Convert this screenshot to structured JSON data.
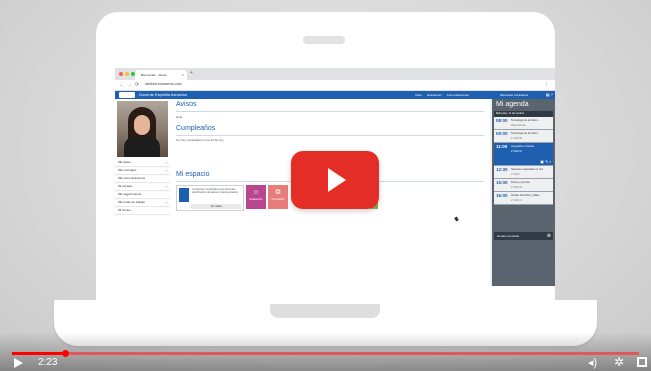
{
  "browser": {
    "tab_title": "Bienvenido · Alexia",
    "url": "alexiadi.educamos.com"
  },
  "app": {
    "title": "Docente Espinilla Asuncion",
    "menu": [
      "Inicio",
      "Evaluación",
      "Comunicaciones"
    ],
    "user": "Mercedes Cantadora"
  },
  "sidebar": {
    "photo_caption": "",
    "items": [
      {
        "label": "Mis datos"
      },
      {
        "label": "Mis mensajes"
      },
      {
        "label": "Mis comunicaciones"
      },
      {
        "label": "Mi espacio"
      },
      {
        "label": "Mis seguimientos"
      },
      {
        "label": "Mis notas de trabajo"
      },
      {
        "label": "Mi Centro"
      }
    ]
  },
  "main": {
    "avisos_title": "Avisos",
    "avisos_text": "Hola",
    "cumple_title": "Cumpleaños",
    "cumple_text": "No hay cumpleaños en la fecha hoy",
    "espacio_title": "Mi espacio",
    "card_desc": "Contenido compartido entre docentes, planificación de tareas y documentación",
    "card_btn": "Ver todos",
    "tiles": [
      {
        "label": "Evaluación",
        "color": "#b9478f",
        "icon": "people-icon"
      },
      {
        "label": "Orientación",
        "color": "#e87c7a",
        "icon": "network-icon"
      },
      {
        "label": "",
        "color": "#8fb45a",
        "icon": ""
      }
    ]
  },
  "agenda": {
    "title": "Mi agenda",
    "date": "Miércoles, 11 de octubre",
    "events": [
      {
        "time": "08:00",
        "name": "Tecnología de la inform...",
        "sub": "Matemáticas"
      },
      {
        "time": "09:00",
        "name": "Tecnología de la inform...",
        "sub": "1º ESO B"
      },
      {
        "time": "11:00",
        "name": "Geografía e historia",
        "sub": "2º ESO A",
        "active": true
      },
      {
        "time": "12:30",
        "name": "Sesiones especiales en red",
        "sub": "2º ESO"
      },
      {
        "time": "15:00",
        "name": "Física y química",
        "sub": "2º ESO B"
      },
      {
        "time": "16:00",
        "name": "Ámbito Científico y Mate...",
        "sub": "2º ESO C"
      }
    ],
    "week_label": "Horario semanal"
  },
  "video": {
    "time": "2:23",
    "progress_fraction": 0.085
  }
}
